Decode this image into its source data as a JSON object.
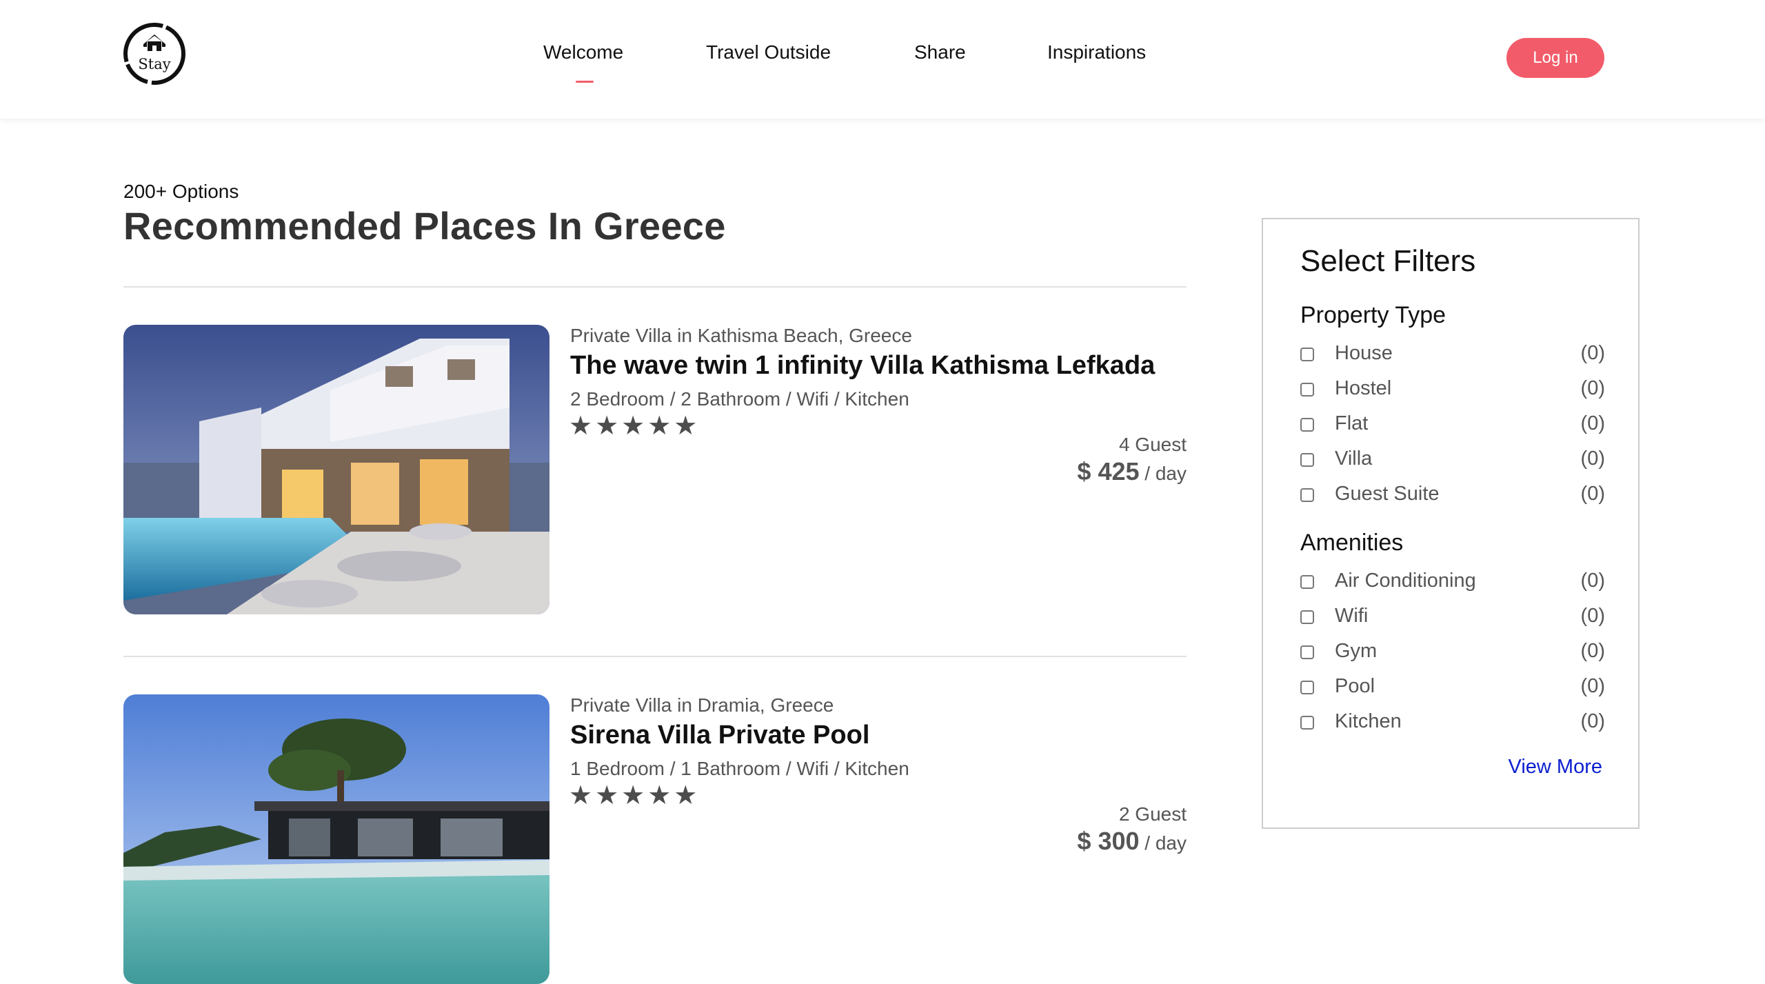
{
  "header": {
    "logo_text": "Stay",
    "nav": [
      "Welcome",
      "Travel Outside",
      "Share",
      "Inspirations"
    ],
    "active_nav": "Welcome",
    "login_label": "Log in",
    "accent_color": "#f25c6a"
  },
  "heading": {
    "subtitle": "200+ Options",
    "title": "Recommended Places In Greece"
  },
  "listings": [
    {
      "location": "Private Villa in Kathisma Beach, Greece",
      "name": "The wave twin 1 infinity Villa Kathisma Lefkada",
      "specs": "2 Bedroom / 2 Bathroom / Wifi / Kitchen",
      "rating": 5,
      "stars": "★★★★★",
      "guests": "4 Guest",
      "price": "$ 425",
      "price_unit": " / day"
    },
    {
      "location": "Private Villa in Dramia, Greece",
      "name": "Sirena Villa Private Pool",
      "specs": "1 Bedroom / 1 Bathroom / Wifi / Kitchen",
      "rating": 5,
      "stars": "★★★★★",
      "guests": "2 Guest",
      "price": "$ 300",
      "price_unit": " / day"
    }
  ],
  "filters": {
    "title": "Select Filters",
    "property_type": {
      "title": "Property Type",
      "options": [
        {
          "label": "House",
          "count": "(0)"
        },
        {
          "label": "Hostel",
          "count": "(0)"
        },
        {
          "label": "Flat",
          "count": "(0)"
        },
        {
          "label": "Villa",
          "count": "(0)"
        },
        {
          "label": "Guest Suite",
          "count": "(0)"
        }
      ]
    },
    "amenities": {
      "title": "Amenities",
      "options": [
        {
          "label": "Air Conditioning",
          "count": "(0)"
        },
        {
          "label": "Wifi",
          "count": "(0)"
        },
        {
          "label": "Gym",
          "count": "(0)"
        },
        {
          "label": "Pool",
          "count": "(0)"
        },
        {
          "label": "Kitchen",
          "count": "(0)"
        }
      ]
    },
    "view_more": "View More"
  }
}
